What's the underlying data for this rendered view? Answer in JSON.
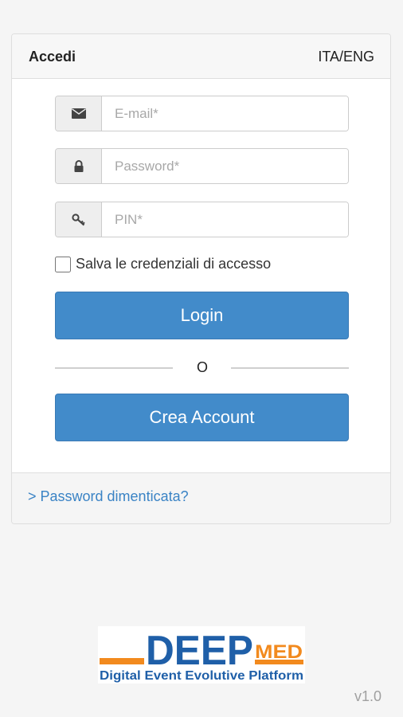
{
  "header": {
    "title": "Accedi",
    "language_switch": "ITA/ENG"
  },
  "form": {
    "email": {
      "placeholder": "E-mail*",
      "icon": "envelope-icon"
    },
    "password": {
      "placeholder": "Password*",
      "icon": "lock-icon"
    },
    "pin": {
      "placeholder": "PIN*",
      "icon": "key-icon"
    },
    "remember_label": "Salva le credenziali di accesso",
    "login_label": "Login",
    "divider_text": "O",
    "create_account_label": "Crea Account"
  },
  "footer": {
    "forgot_password": "> Password dimenticata?"
  },
  "logo": {
    "word": "DEEP",
    "suffix": "MED",
    "tagline": "Digital Event Evolutive Platform"
  },
  "version": "v1.0",
  "colors": {
    "primary_button": "#428bca",
    "link": "#3a83c5",
    "logo_blue": "#1f5fa8",
    "logo_orange": "#f28a1e"
  }
}
